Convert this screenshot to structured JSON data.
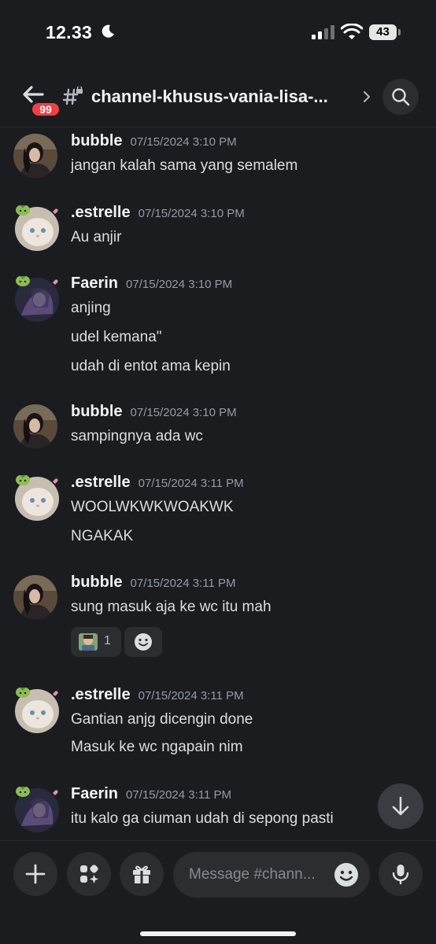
{
  "status_bar": {
    "time": "12.33",
    "battery": "43"
  },
  "header": {
    "unread_badge": "99",
    "channel_name": "channel-khusus-vania-lisa-..."
  },
  "messages": [
    {
      "author": "bubble",
      "timestamp": "07/15/2024 3:10 PM",
      "lines": [
        "jangan kalah sama yang semalem"
      ]
    },
    {
      "author": ".estrelle",
      "timestamp": "07/15/2024 3:10 PM",
      "lines": [
        "Au anjir"
      ]
    },
    {
      "author": "Faerin",
      "timestamp": "07/15/2024 3:10 PM",
      "lines": [
        "anjing",
        "udel kemana\"",
        "udah di entot ama kepin"
      ]
    },
    {
      "author": "bubble",
      "timestamp": "07/15/2024 3:10 PM",
      "lines": [
        "sampingnya ada wc"
      ]
    },
    {
      "author": ".estrelle",
      "timestamp": "07/15/2024 3:11 PM",
      "lines": [
        "WOOLWKWKWOAKWK",
        "NGAKAK"
      ]
    },
    {
      "author": "bubble",
      "timestamp": "07/15/2024 3:11 PM",
      "lines": [
        "sung masuk aja ke wc itu mah"
      ],
      "reaction_count": "1"
    },
    {
      "author": ".estrelle",
      "timestamp": "07/15/2024 3:11 PM",
      "lines": [
        "Gantian anjg dicengin done",
        "Masuk ke wc ngapain nim"
      ]
    },
    {
      "author": "Faerin",
      "timestamp": "07/15/2024 3:11 PM",
      "lines": [
        "itu kalo ga ciuman udah di sepong pasti"
      ]
    }
  ],
  "composer": {
    "placeholder": "Message #chann..."
  },
  "icons": {
    "back": "arrow-left-icon",
    "channel": "hash-lock-icon",
    "search": "search-icon",
    "scroll_down": "arrow-down-icon",
    "add": "plus-icon",
    "apps": "apps-icon",
    "gift": "gift-icon",
    "emoji": "emoji-icon",
    "mic": "microphone-icon"
  },
  "colors": {
    "background": "#1b1c20",
    "surface": "#2b2d31",
    "badge": "#f23f43",
    "text": "#dbdee1",
    "muted": "#949ba4"
  }
}
